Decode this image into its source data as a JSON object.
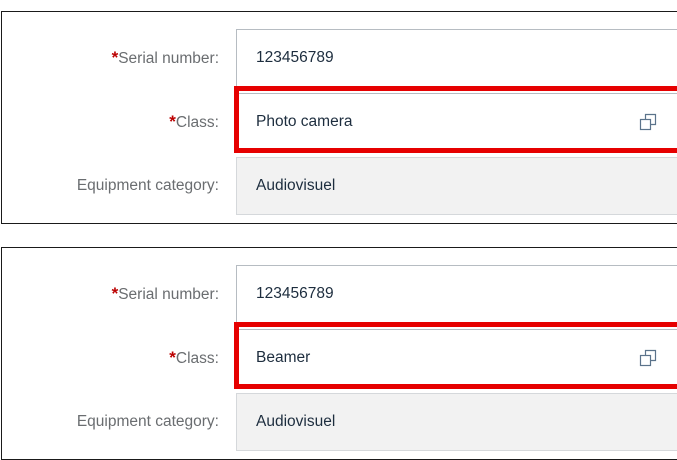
{
  "panels": [
    {
      "fields": {
        "serial": {
          "required_mark": "*",
          "label": "Serial number:",
          "value": "123456789"
        },
        "class": {
          "required_mark": "*",
          "label": "Class:",
          "value": "Photo camera",
          "icon": "value-help-icon"
        },
        "category": {
          "label": "Equipment category:",
          "value": "Audiovisuel"
        }
      }
    },
    {
      "fields": {
        "serial": {
          "required_mark": "*",
          "label": "Serial number:",
          "value": "123456789"
        },
        "class": {
          "required_mark": "*",
          "label": "Class:",
          "value": "Beamer",
          "icon": "value-help-icon"
        },
        "category": {
          "label": "Equipment category:",
          "value": "Audiovisuel"
        }
      }
    }
  ],
  "colors": {
    "required_star": "#bb0000",
    "highlight_border": "#e60000",
    "label_text": "#6a6d70",
    "value_text": "#1d2d3e",
    "readonly_background": "#f2f2f2"
  }
}
